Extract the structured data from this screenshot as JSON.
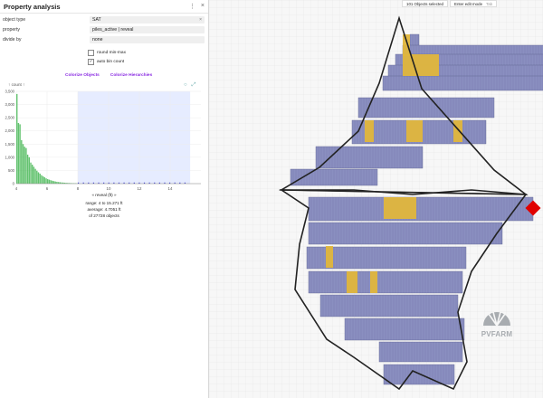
{
  "panel": {
    "title": "Property analysis",
    "more_icon": "more-vertical-icon",
    "close_icon": "close-icon",
    "rows": [
      {
        "label": "object type",
        "value": "SAT",
        "clear": "×"
      },
      {
        "label": "property",
        "value": "piles_active | reveal"
      },
      {
        "label": "divide by",
        "value": "none"
      }
    ],
    "round_min_max": "round min-max",
    "auto_bin_count": "auto bin count",
    "colorize_objects": "Colorize Objects",
    "colorize_hierarchies": "Colorize Hierarchies",
    "hist_count_label": "↑ count ↑",
    "hist_xlabel": "« reveal (ft) »",
    "range_text": "range: 4 to 15.271 ft",
    "average_text": "average: 4.7051 ft",
    "objects_text": "of 27728 objects"
  },
  "toolbar": {
    "selected": "101 Objects selected",
    "edit_mode": "Enter edit mode",
    "shortcut": "Tab"
  },
  "logo": {
    "text": "PVFARM"
  },
  "colors": {
    "hist_bar": "#3cb44b",
    "selection": "#e6ecff",
    "panel_block": "#8a8fc0",
    "highlight": "#e0b63c",
    "marker": "#e00000"
  },
  "chart_data": {
    "type": "bar",
    "ylabel": "count",
    "xlabel": "reveal (ft)",
    "ylim": [
      0,
      3500
    ],
    "xlim": [
      4,
      16
    ],
    "xticks": [
      4,
      6,
      8,
      10,
      12,
      14
    ],
    "yticks": [
      0,
      500,
      1000,
      1500,
      2000,
      2500,
      3000,
      3500
    ],
    "ytick_labels": [
      "0",
      "500",
      "1,000",
      "1,500",
      "2,000",
      "2,500",
      "3,000",
      "3,500"
    ],
    "selected_range": [
      8,
      15.3
    ],
    "bin_start": 4,
    "bin_width": 0.1,
    "values": [
      3400,
      2300,
      2250,
      1650,
      1500,
      1400,
      1350,
      1100,
      1000,
      800,
      720,
      640,
      560,
      490,
      430,
      380,
      320,
      280,
      240,
      200,
      170,
      150,
      130,
      110,
      95,
      80,
      70,
      60,
      52,
      45,
      40,
      35,
      30,
      26,
      22,
      19,
      16,
      14,
      12,
      10
    ]
  }
}
